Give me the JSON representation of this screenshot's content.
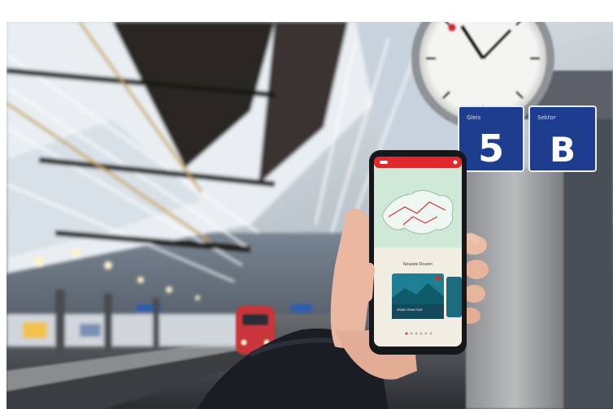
{
  "scene": {
    "description_colors": {
      "roof_light": "#e9eef2",
      "roof_dark": "#2e2a27",
      "platform_floor": "#55585c",
      "sign_blue": "#1f3d8f",
      "train_red": "#c8343a",
      "sleeve": "#1a1d24",
      "skin": "#e9b7a0",
      "app_red": "#e0282d",
      "map_green": "#cfe8d8",
      "card_teal": "#1e7f93"
    }
  },
  "signs": {
    "platform_prefix": "Gleis",
    "platform_number": "5",
    "sector_prefix": "Sektor",
    "sector_letter": "B"
  },
  "phone": {
    "app_section_title": "Neueste Routen",
    "card_label": "GRAND TRAIN TOUR"
  }
}
